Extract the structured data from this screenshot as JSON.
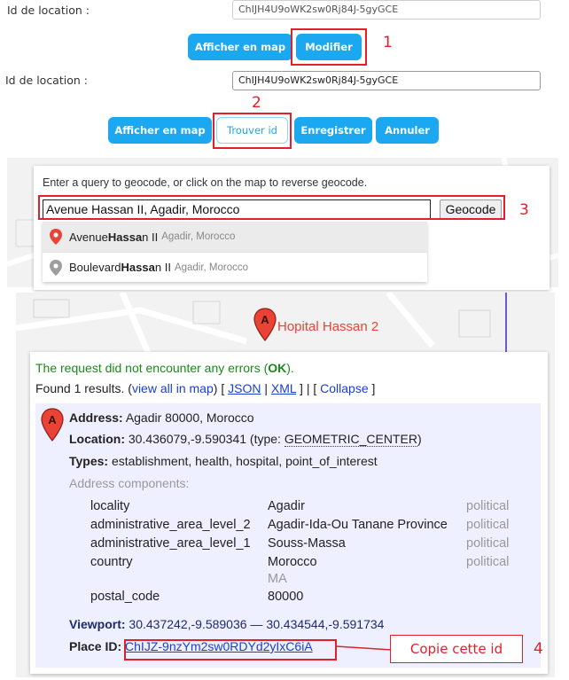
{
  "form_top": {
    "label": "Id de location :",
    "value": "ChIJH4U9oWK2sw0Rj84J-5gyGCE",
    "show_map_label": "Afficher en map",
    "edit_label": "Modifier"
  },
  "form_edit": {
    "label": "Id de location :",
    "value": "ChIJH4U9oWK2sw0Rj84J-5gyGCE",
    "show_map_label": "Afficher en map",
    "find_id_label": "Trouver id",
    "save_label": "Enregistrer",
    "cancel_label": "Annuler"
  },
  "annotations": {
    "step1": "1",
    "step2": "2",
    "step3": "3",
    "step4": "4",
    "callout": "Copie cette id"
  },
  "geocoder": {
    "hint": "Enter a query to geocode, or click on the map to reverse geocode.",
    "query": "Avenue Hassan II, Agadir, Morocco",
    "button": "Geocode",
    "suggestions": [
      {
        "pre": "Avenue ",
        "bold": "Hassa",
        "post": "n II",
        "secondary": "Agadir, Morocco",
        "pin_color": "#ea4335"
      },
      {
        "pre": "Boulevard ",
        "bold": "Hassa",
        "post": "n II",
        "secondary": "Agadir, Morocco",
        "pin_color": "#9e9e9e"
      }
    ]
  },
  "map_marker": {
    "letter": "A",
    "label": "Hopital Hassan 2",
    "label_color": "#ea4335"
  },
  "result": {
    "ok_prefix": "The request did not encounter any errors (",
    "ok_word": "OK",
    "ok_suffix": ").",
    "found_text": "Found 1 results. (",
    "view_all": "view all in map",
    "found_mid": ") [ ",
    "json": "JSON",
    "sep": " | ",
    "xml": "XML",
    "found_mid2": " ] | [ ",
    "collapse": "Collapse",
    "found_end": " ]",
    "address_key": "Address:",
    "address_val": "Agadir 80000, Morocco",
    "location_key": "Location:",
    "location_val": "30.436079,-9.590341",
    "location_type_prefix": "(type: ",
    "location_type": "GEOMETRIC_CENTER",
    "location_type_suffix": ")",
    "types_key": "Types:",
    "types_val": "establishment, health, hospital, point_of_interest",
    "components_title": "Address components:",
    "components": [
      {
        "type": "locality",
        "long": "Agadir",
        "short": "",
        "tag": "political"
      },
      {
        "type": "administrative_area_level_2",
        "long": "Agadir-Ida-Ou Tanane Province",
        "short": "",
        "tag": "political"
      },
      {
        "type": "administrative_area_level_1",
        "long": "Souss-Massa",
        "short": "",
        "tag": "political"
      },
      {
        "type": "country",
        "long": "Morocco",
        "short": "MA",
        "tag": "political"
      },
      {
        "type": "postal_code",
        "long": "80000",
        "short": "",
        "tag": ""
      }
    ],
    "viewport_key": "Viewport:",
    "viewport_val": "30.437242,-9.589036 — 30.434544,-9.591734",
    "place_id_key": "Place ID:",
    "place_id_val": "ChIJZ-9nzYm2sw0RDYd2yIxC6iA"
  }
}
